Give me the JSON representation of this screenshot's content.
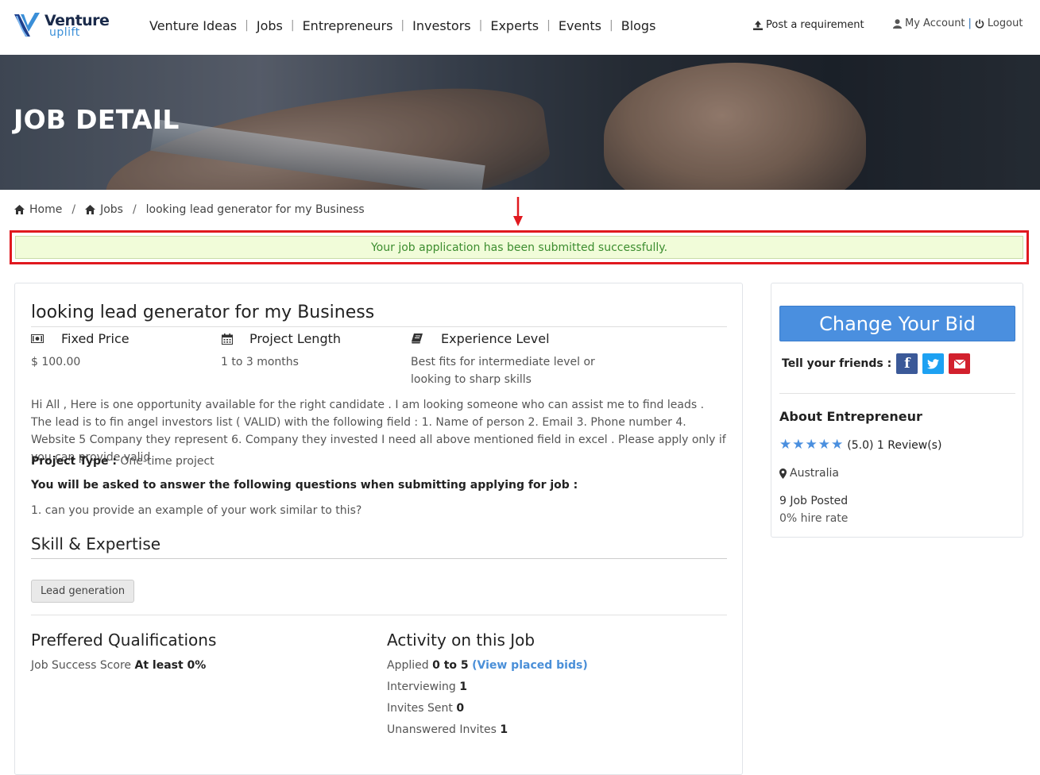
{
  "brand": {
    "line1": "Venture",
    "line2": "uplift"
  },
  "nav": [
    "Venture Ideas",
    "Jobs",
    "Entrepreneurs",
    "Investors",
    "Experts",
    "Events",
    "Blogs"
  ],
  "nav_separator": "|",
  "header_actions": {
    "post": "Post a requirement",
    "account": "My Account",
    "sep": "|",
    "logout": "Logout"
  },
  "banner": {
    "title": "JOB DETAIL"
  },
  "breadcrumb": {
    "home": "Home",
    "jobs": "Jobs",
    "current": "looking lead generator for my Business",
    "sep": "/"
  },
  "alert": {
    "message": "Your job application has been submitted successfully."
  },
  "job": {
    "title": "looking lead generator for my Business",
    "price_label": "Fixed Price",
    "price_value": "$ 100.00",
    "length_label": "Project Length",
    "length_value": "1 to 3 months",
    "experience_label": "Experience Level",
    "experience_value_1": "Best fits for intermediate level or",
    "experience_value_2": "looking to sharp skills",
    "description": "Hi All , Here is one opportunity available for the right candidate . I am looking someone who can assist me to find leads . The lead is to fin angel investors list ( VALID) with the following field : 1. Name of person 2. Email 3. Phone number 4. Website 5 Company they represent 6. Company they invested I need all above mentioned field in excel . Please apply only if you can provide valid .",
    "project_type_label": "Project Type :",
    "project_type_value": "One-time project",
    "questions_note": "You will be asked to answer the following questions when submitting applying for job :",
    "question_1": "1. can you provide an example of your work similar to this?",
    "skills_heading": "Skill & Expertise",
    "skills": [
      "Lead generation"
    ],
    "qualifications_heading": "Preffered Qualifications",
    "qual_label": "Job Success Score",
    "qual_value": "At least 0%",
    "activity_heading": "Activity on this Job",
    "applied_label": "Applied",
    "applied_value": "0 to 5",
    "view_bids": "(View placed bids)",
    "interviewing_label": "Interviewing",
    "interviewing_value": "1",
    "invites_label": "Invites Sent",
    "invites_value": "0",
    "unanswered_label": "Unanswered Invites",
    "unanswered_value": "1"
  },
  "sidebar": {
    "bid_button": "Change Your Bid",
    "share_label": "Tell your friends :",
    "share_fb": "f",
    "about_heading": "About Entrepreneur",
    "rating_stars": 5,
    "rating_text": "(5.0) 1 Review(s)",
    "location": "Australia",
    "jobs_posted": "9 Job Posted",
    "hire_rate": "0% hire rate"
  },
  "colors": {
    "accent": "#4a8fdf",
    "success_text": "#3c8d2f",
    "alert_bg": "#f1fcd9",
    "highlight": "#e0191f"
  }
}
